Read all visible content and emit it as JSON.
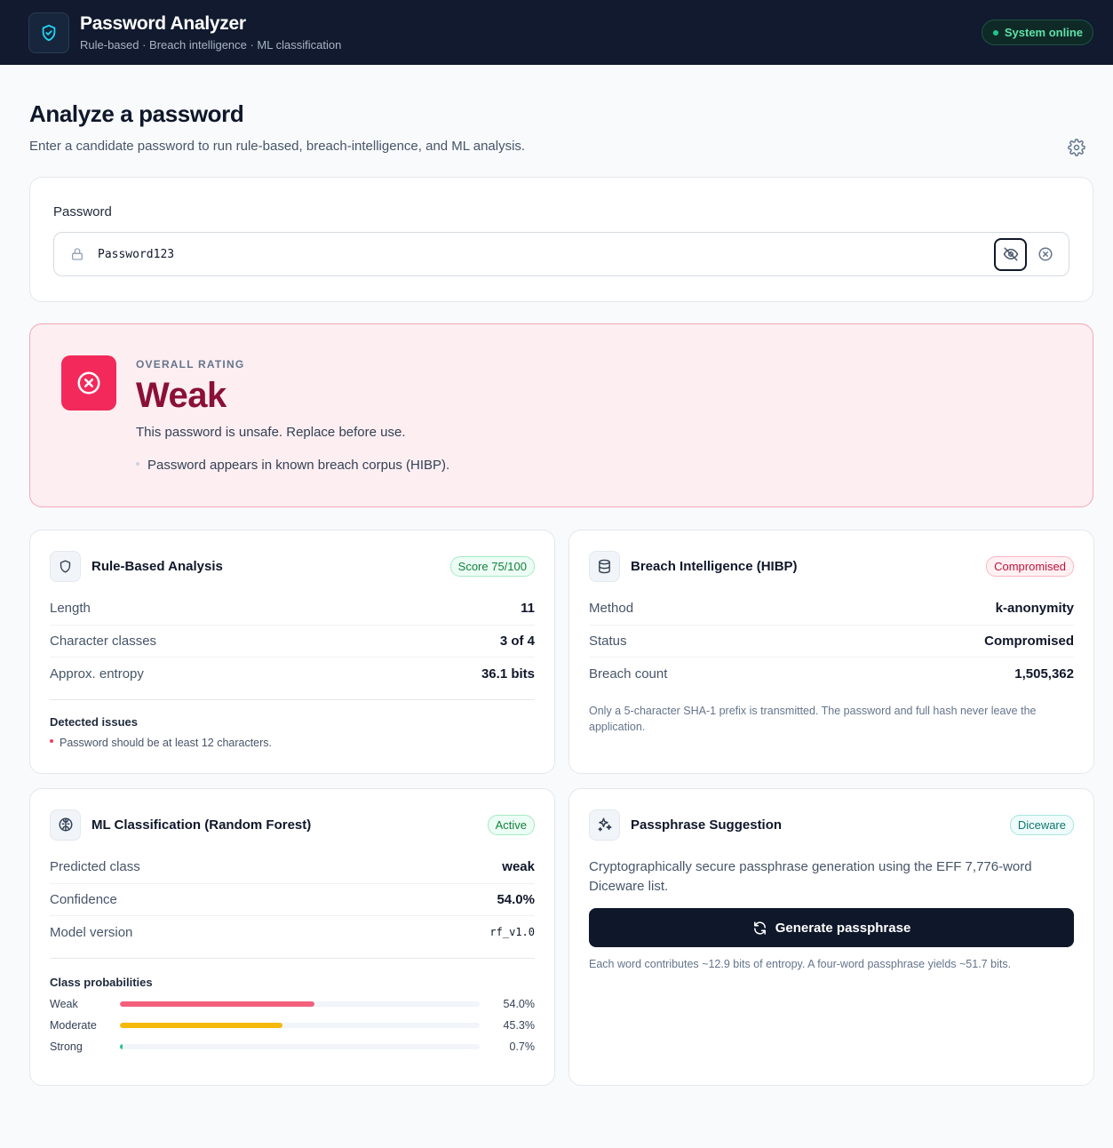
{
  "app": {
    "title": "Password Analyzer",
    "subtitle": "Rule-based · Breach intelligence · ML classification",
    "status": "System online",
    "colors": {
      "header_bg": "#111a2e",
      "accent": "#22c58b",
      "danger": "#f2295a"
    }
  },
  "page": {
    "title": "Analyze a password",
    "description": "Enter a candidate password to run rule-based, breach-intelligence, and ML analysis."
  },
  "password": {
    "label": "Password",
    "value": "Password123",
    "icons": [
      "lock-icon",
      "eye-off-icon",
      "clear-icon"
    ]
  },
  "rating": {
    "kicker": "OVERALL RATING",
    "value": "Weak",
    "description": "This password is unsafe. Replace before use.",
    "bullets": [
      "Password appears in known breach corpus (HIBP)."
    ]
  },
  "rule": {
    "title": "Rule-Based Analysis",
    "badge": "Score 75/100",
    "rows": [
      {
        "k": "Length",
        "v": "11"
      },
      {
        "k": "Character classes",
        "v": "3 of 4"
      },
      {
        "k": "Approx. entropy",
        "v": "36.1 bits"
      }
    ],
    "issues_title": "Detected issues",
    "issues": [
      "Password should be at least 12 characters."
    ]
  },
  "breach": {
    "title": "Breach Intelligence (HIBP)",
    "badge": "Compromised",
    "rows": [
      {
        "k": "Method",
        "v": "k-anonymity"
      },
      {
        "k": "Status",
        "v": "Compromised"
      },
      {
        "k": "Breach count",
        "v": "1,505,362"
      }
    ],
    "note": "Only a 5-character SHA-1 prefix is transmitted. The password and full hash never leave the application."
  },
  "ml": {
    "title": "ML Classification (Random Forest)",
    "badge": "Active",
    "rows": [
      {
        "k": "Predicted class",
        "v": "weak"
      },
      {
        "k": "Confidence",
        "v": "54.0%"
      },
      {
        "k": "Model version",
        "v": "rf_v1.0"
      }
    ],
    "probs_title": "Class probabilities",
    "probs": [
      {
        "label": "Weak",
        "text": "54.0%",
        "value": 0.54,
        "color": "#f3607c"
      },
      {
        "label": "Moderate",
        "text": "45.3%",
        "value": 0.453,
        "color": "#f5b80b"
      },
      {
        "label": "Strong",
        "text": "0.7%",
        "value": 0.007,
        "color": "#22c58b"
      }
    ]
  },
  "passphrase": {
    "title": "Passphrase Suggestion",
    "badge": "Diceware",
    "description": "Cryptographically secure passphrase generation using the EFF 7,776-word Diceware list.",
    "button": "Generate passphrase",
    "note": "Each word contributes ~12.9 bits of entropy. A four-word passphrase yields ~51.7 bits."
  }
}
